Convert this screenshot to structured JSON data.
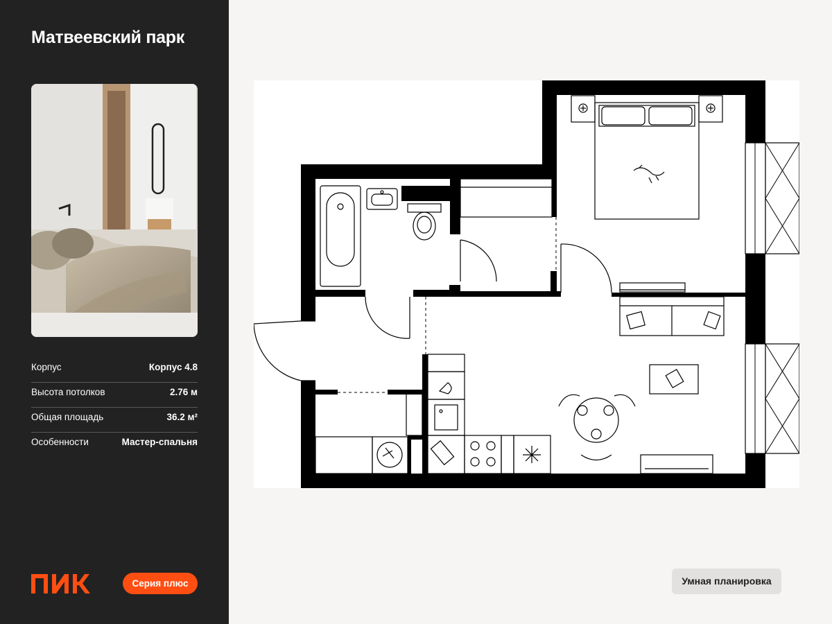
{
  "project": {
    "title": "Матвеевский парк"
  },
  "photo": {
    "alt": "Интерьер спальни"
  },
  "specs": [
    {
      "label": "Корпус",
      "value": "Корпус 4.8"
    },
    {
      "label": "Высота потолков",
      "value": "2.76 м"
    },
    {
      "label": "Общая площадь",
      "value": "36.2 м²"
    },
    {
      "label": "Особенности",
      "value": "Мастер-спальня"
    }
  ],
  "footer": {
    "logo_text": "ПИК",
    "series_badge": "Серия плюс",
    "smart_badge": "Умная планировка"
  },
  "colors": {
    "sidebar_bg": "#222222",
    "accent": "#ff4e12",
    "page_bg": "#f6f5f3",
    "wall": "#000000"
  }
}
